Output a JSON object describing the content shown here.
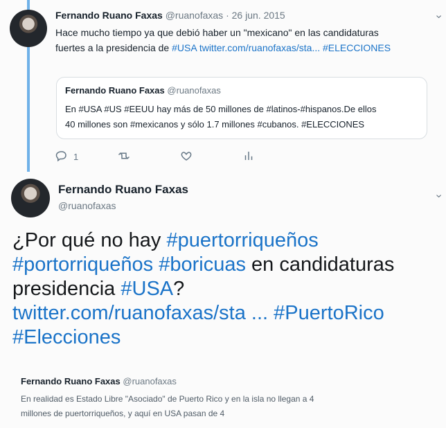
{
  "tweet1": {
    "name": "Fernando Ruano Faxas",
    "handle": "@ruanofaxas",
    "sep": " · ",
    "date": "26 jun. 2015",
    "text1": "Hace mucho tiempo ya que debió haber un \"mexicano\" en las candidaturas",
    "text2a": "fuertes a la presidencia de ",
    "hashtag_usa": "#USA",
    "link": "twitter.com/ruanofaxas/sta...",
    "hashtag_elecciones": "#ELECCIONES",
    "quote": {
      "name": "Fernando Ruano Faxas",
      "handle": "@ruanofaxas",
      "line1": "En #USA #US #EEUU hay más de 50 millones de #latinos-#hispanos.De ellos",
      "line2": "40 millones son #mexicanos y sólo 1.7 millones #cubanos. #ELECCIONES"
    },
    "actions": {
      "reply_count": "1",
      "retweet_count": "",
      "like_count": "",
      "analytics_count": ""
    }
  },
  "tweet2": {
    "name": "Fernando Ruano Faxas",
    "handle": "@ruanofaxas",
    "line1_prefix": "¿Por qué no hay ",
    "line1_hashtag": "#puertorriqueños",
    "line2_hashtag_a": "#portorriqueños",
    "line2_space": " ",
    "line2_hashtag_b": "#boricuas",
    "line2_suffix": " en candidaturas",
    "line3_prefix": "presidencia ",
    "line3_hashtag": "#USA",
    "line3_suffix": "?",
    "line4_link": "twitter.com/ruanofaxas/sta ...",
    "line4_space": " ",
    "line4_hashtag": "#PuertoRico",
    "line5_hashtag": "#Elecciones",
    "quote": {
      "name": "Fernando Ruano Faxas",
      "handle": "@ruanofaxas",
      "line1": "En realidad es Estado Libre \"Asociado\" de Puerto Rico y en la isla no llegan a 4",
      "line2": "millones de puertorriqueños, y aquí en USA pasan de 4"
    }
  },
  "icons": {
    "caret": "chevron-down-icon",
    "reply": "reply-icon",
    "retweet": "retweet-icon",
    "like": "heart-icon",
    "analytics": "analytics-icon"
  }
}
